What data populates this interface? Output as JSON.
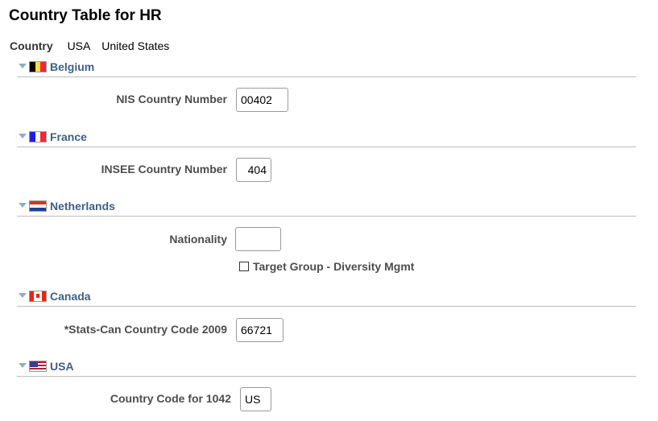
{
  "page": {
    "title": "Country Table for HR"
  },
  "country": {
    "label": "Country",
    "code": "USA",
    "name": "United States"
  },
  "sections": {
    "belgium": {
      "title": "Belgium",
      "field_label": "NIS Country Number",
      "field_value": "00402",
      "flag_colors": [
        "#000000",
        "#fae042",
        "#ed2939"
      ]
    },
    "france": {
      "title": "France",
      "field_label": "INSEE Country Number",
      "field_value": "404",
      "flag_colors": [
        "#1f1fe0",
        "#ffffff",
        "#ed2939"
      ]
    },
    "netherlands": {
      "title": "Netherlands",
      "field_label": "Nationality",
      "field_value": "",
      "checkbox_label": "Target Group - Diversity Mgmt",
      "checkbox_checked": false,
      "flag_colors": [
        "#d03a10",
        "#ffffff",
        "#1e3f9a"
      ]
    },
    "canada": {
      "title": "Canada",
      "field_label": "*Stats-Can Country Code 2009",
      "field_value": "66721",
      "flag_colors": [
        "#ee2211",
        "#ffffff",
        "#ee2211"
      ]
    },
    "usa": {
      "title": "USA",
      "field_label": "Country Code for 1042",
      "field_value": "US",
      "flag_colors": [
        "#b22234",
        "#ffffff",
        "#3c3b8e"
      ]
    }
  },
  "colors": {
    "section_title": "#3d5f8c",
    "expand_triangle": "#8aaecb",
    "divider": "#bdbdbd"
  }
}
